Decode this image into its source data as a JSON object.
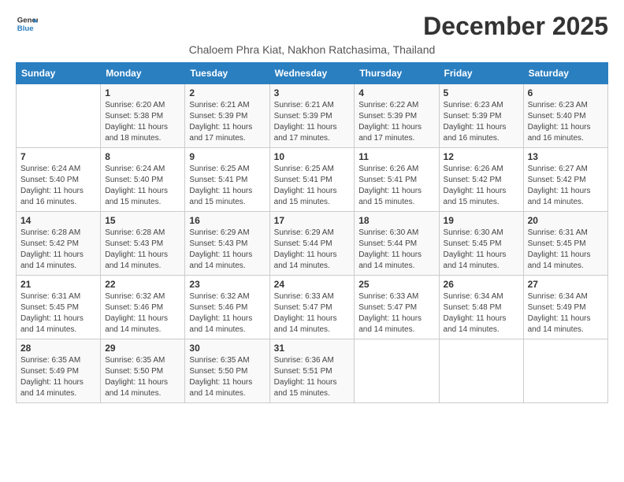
{
  "logo": {
    "line1": "General",
    "line2": "Blue"
  },
  "title": "December 2025",
  "subtitle": "Chaloem Phra Kiat, Nakhon Ratchasima, Thailand",
  "weekdays": [
    "Sunday",
    "Monday",
    "Tuesday",
    "Wednesday",
    "Thursday",
    "Friday",
    "Saturday"
  ],
  "weeks": [
    [
      {
        "day": "",
        "info": ""
      },
      {
        "day": "1",
        "info": "Sunrise: 6:20 AM\nSunset: 5:38 PM\nDaylight: 11 hours\nand 18 minutes."
      },
      {
        "day": "2",
        "info": "Sunrise: 6:21 AM\nSunset: 5:39 PM\nDaylight: 11 hours\nand 17 minutes."
      },
      {
        "day": "3",
        "info": "Sunrise: 6:21 AM\nSunset: 5:39 PM\nDaylight: 11 hours\nand 17 minutes."
      },
      {
        "day": "4",
        "info": "Sunrise: 6:22 AM\nSunset: 5:39 PM\nDaylight: 11 hours\nand 17 minutes."
      },
      {
        "day": "5",
        "info": "Sunrise: 6:23 AM\nSunset: 5:39 PM\nDaylight: 11 hours\nand 16 minutes."
      },
      {
        "day": "6",
        "info": "Sunrise: 6:23 AM\nSunset: 5:40 PM\nDaylight: 11 hours\nand 16 minutes."
      }
    ],
    [
      {
        "day": "7",
        "info": "Sunrise: 6:24 AM\nSunset: 5:40 PM\nDaylight: 11 hours\nand 16 minutes."
      },
      {
        "day": "8",
        "info": "Sunrise: 6:24 AM\nSunset: 5:40 PM\nDaylight: 11 hours\nand 15 minutes."
      },
      {
        "day": "9",
        "info": "Sunrise: 6:25 AM\nSunset: 5:41 PM\nDaylight: 11 hours\nand 15 minutes."
      },
      {
        "day": "10",
        "info": "Sunrise: 6:25 AM\nSunset: 5:41 PM\nDaylight: 11 hours\nand 15 minutes."
      },
      {
        "day": "11",
        "info": "Sunrise: 6:26 AM\nSunset: 5:41 PM\nDaylight: 11 hours\nand 15 minutes."
      },
      {
        "day": "12",
        "info": "Sunrise: 6:26 AM\nSunset: 5:42 PM\nDaylight: 11 hours\nand 15 minutes."
      },
      {
        "day": "13",
        "info": "Sunrise: 6:27 AM\nSunset: 5:42 PM\nDaylight: 11 hours\nand 14 minutes."
      }
    ],
    [
      {
        "day": "14",
        "info": "Sunrise: 6:28 AM\nSunset: 5:42 PM\nDaylight: 11 hours\nand 14 minutes."
      },
      {
        "day": "15",
        "info": "Sunrise: 6:28 AM\nSunset: 5:43 PM\nDaylight: 11 hours\nand 14 minutes."
      },
      {
        "day": "16",
        "info": "Sunrise: 6:29 AM\nSunset: 5:43 PM\nDaylight: 11 hours\nand 14 minutes."
      },
      {
        "day": "17",
        "info": "Sunrise: 6:29 AM\nSunset: 5:44 PM\nDaylight: 11 hours\nand 14 minutes."
      },
      {
        "day": "18",
        "info": "Sunrise: 6:30 AM\nSunset: 5:44 PM\nDaylight: 11 hours\nand 14 minutes."
      },
      {
        "day": "19",
        "info": "Sunrise: 6:30 AM\nSunset: 5:45 PM\nDaylight: 11 hours\nand 14 minutes."
      },
      {
        "day": "20",
        "info": "Sunrise: 6:31 AM\nSunset: 5:45 PM\nDaylight: 11 hours\nand 14 minutes."
      }
    ],
    [
      {
        "day": "21",
        "info": "Sunrise: 6:31 AM\nSunset: 5:45 PM\nDaylight: 11 hours\nand 14 minutes."
      },
      {
        "day": "22",
        "info": "Sunrise: 6:32 AM\nSunset: 5:46 PM\nDaylight: 11 hours\nand 14 minutes."
      },
      {
        "day": "23",
        "info": "Sunrise: 6:32 AM\nSunset: 5:46 PM\nDaylight: 11 hours\nand 14 minutes."
      },
      {
        "day": "24",
        "info": "Sunrise: 6:33 AM\nSunset: 5:47 PM\nDaylight: 11 hours\nand 14 minutes."
      },
      {
        "day": "25",
        "info": "Sunrise: 6:33 AM\nSunset: 5:47 PM\nDaylight: 11 hours\nand 14 minutes."
      },
      {
        "day": "26",
        "info": "Sunrise: 6:34 AM\nSunset: 5:48 PM\nDaylight: 11 hours\nand 14 minutes."
      },
      {
        "day": "27",
        "info": "Sunrise: 6:34 AM\nSunset: 5:49 PM\nDaylight: 11 hours\nand 14 minutes."
      }
    ],
    [
      {
        "day": "28",
        "info": "Sunrise: 6:35 AM\nSunset: 5:49 PM\nDaylight: 11 hours\nand 14 minutes."
      },
      {
        "day": "29",
        "info": "Sunrise: 6:35 AM\nSunset: 5:50 PM\nDaylight: 11 hours\nand 14 minutes."
      },
      {
        "day": "30",
        "info": "Sunrise: 6:35 AM\nSunset: 5:50 PM\nDaylight: 11 hours\nand 14 minutes."
      },
      {
        "day": "31",
        "info": "Sunrise: 6:36 AM\nSunset: 5:51 PM\nDaylight: 11 hours\nand 15 minutes."
      },
      {
        "day": "",
        "info": ""
      },
      {
        "day": "",
        "info": ""
      },
      {
        "day": "",
        "info": ""
      }
    ]
  ]
}
